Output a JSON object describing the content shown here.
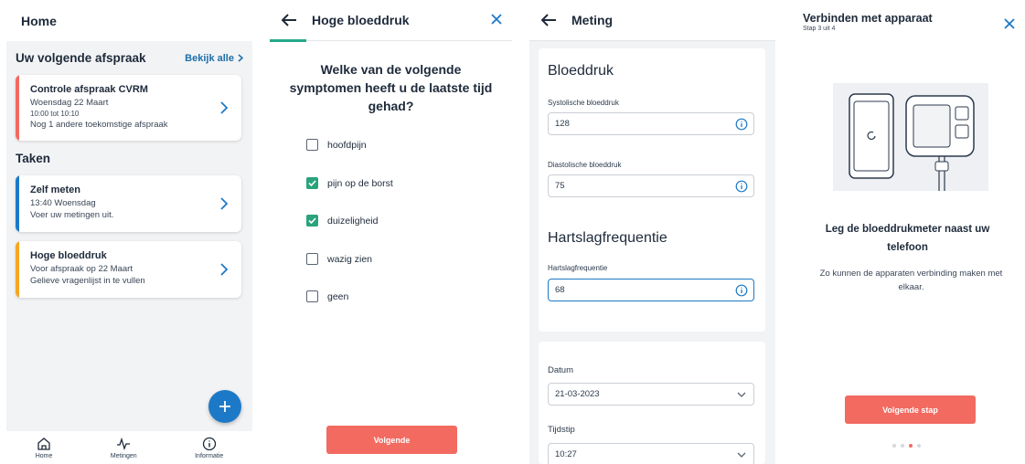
{
  "home": {
    "title": "Home",
    "next_appointment_heading": "Uw volgende afspraak",
    "see_all": "Bekijk alle",
    "appointment": {
      "title": "Controle afspraak CVRM",
      "date": "Woensdag 22 Maart",
      "time": "10:00 tot 10:10",
      "note": "Nog 1 andere toekomstige afspraak",
      "accent": "#f26a60"
    },
    "tasks_heading": "Taken",
    "tasks": [
      {
        "title": "Zelf meten",
        "line1": "13:40 Woensdag",
        "line2": "Voer uw metingen uit.",
        "accent": "#1c79c7"
      },
      {
        "title": "Hoge bloeddruk",
        "line1": "Voor afspraak op 22 Maart",
        "line2": "Gelieve vragenlijst in te vullen",
        "accent": "#f5a623"
      }
    ],
    "fab_icon": "plus-icon",
    "nav": [
      {
        "label": "Home",
        "icon": "home-icon"
      },
      {
        "label": "Metingen",
        "icon": "activity-icon"
      },
      {
        "label": "Informatie",
        "icon": "info-icon"
      }
    ]
  },
  "questionnaire": {
    "title": "Hoge bloeddruk",
    "question": "Welke van de volgende symptomen heeft u de laatste tijd gehad?",
    "options": [
      {
        "label": "hoofdpijn",
        "checked": false
      },
      {
        "label": "pijn op de borst",
        "checked": true
      },
      {
        "label": "duizeligheid",
        "checked": true
      },
      {
        "label": "wazig zien",
        "checked": false
      },
      {
        "label": "geen",
        "checked": false
      }
    ],
    "next_button": "Volgende",
    "accent": "#25a98b"
  },
  "measurement": {
    "title": "Meting",
    "bp_heading": "Bloeddruk",
    "systolic_label": "Systolische bloeddruk",
    "systolic_value": "128",
    "diastolic_label": "Diastolische bloeddruk",
    "diastolic_value": "75",
    "hr_heading": "Hartslagfrequentie",
    "hr_label": "Hartslagfrequentie",
    "hr_value": "68",
    "date_label": "Datum",
    "date_value": "21-03-2023",
    "time_label": "Tijdstip",
    "time_value": "10:27"
  },
  "connect": {
    "title": "Verbinden met apparaat",
    "step": "Stap 3 uit 4",
    "heading": "Leg de bloeddrukmeter naast uw telefoon",
    "body": "Zo kunnen de apparaten verbinding maken met elkaar.",
    "next_button": "Volgende stap",
    "current_step": 3,
    "total_steps": 4
  }
}
